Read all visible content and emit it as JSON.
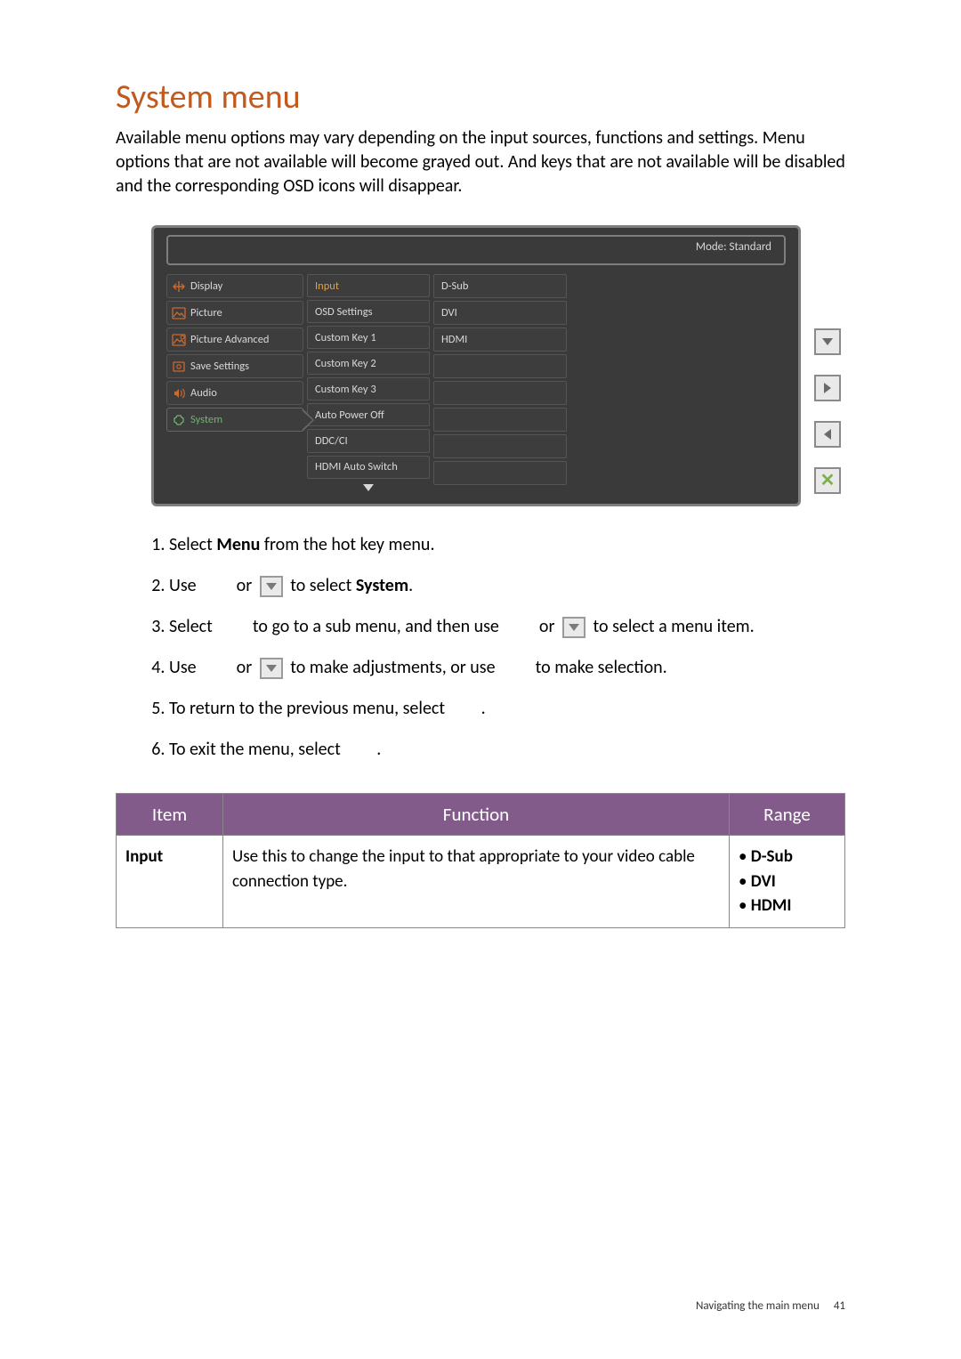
{
  "title": "System menu",
  "intro": "Available menu options may vary depending on the input sources, functions and settings. Menu options that are not available will become grayed out. And keys that are not available will be disabled and the corresponding OSD icons will disappear.",
  "osd": {
    "mode_label": "Mode: Standard",
    "tabs": [
      {
        "label": "Display",
        "icon": "display"
      },
      {
        "label": "Picture",
        "icon": "picture"
      },
      {
        "label": "Picture Advanced",
        "icon": "picture-adv"
      },
      {
        "label": "Save Settings",
        "icon": "save"
      },
      {
        "label": "Audio",
        "icon": "audio"
      },
      {
        "label": "System",
        "icon": "system",
        "selected": true
      }
    ],
    "submenu": [
      "Input",
      "OSD Settings",
      "Custom Key 1",
      "Custom Key 2",
      "Custom Key 3",
      "Auto Power Off",
      "DDC/CI",
      "HDMI Auto Switch"
    ],
    "options": [
      "D-Sub",
      "DVI",
      "HDMI"
    ]
  },
  "steps": {
    "s1_a": "Select ",
    "s1_b": "Menu",
    "s1_c": " from the hot key menu.",
    "s2_a": "Use ",
    "s2_b": " or ",
    "s2_c": " to select ",
    "s2_d": "System",
    "s2_e": ".",
    "s3_a": "Select ",
    "s3_b": " to go to a sub menu, and then use ",
    "s3_c": " or ",
    "s3_d": " to select a menu item.",
    "s4_a": "Use ",
    "s4_b": " or ",
    "s4_c": " to make adjustments, or use ",
    "s4_d": " to make selection.",
    "s5_a": "To return to the previous menu, select ",
    "s5_b": ".",
    "s6_a": "To exit the menu, select ",
    "s6_b": "."
  },
  "table": {
    "headers": {
      "item": "Item",
      "function": "Function",
      "range": "Range"
    },
    "row": {
      "item": "Input",
      "function": "Use this to change the input to that appropriate to your video cable connection type.",
      "range": [
        "D-Sub",
        "DVI",
        "HDMI"
      ]
    }
  },
  "footer": {
    "text": "Navigating the main menu",
    "page": "41"
  }
}
